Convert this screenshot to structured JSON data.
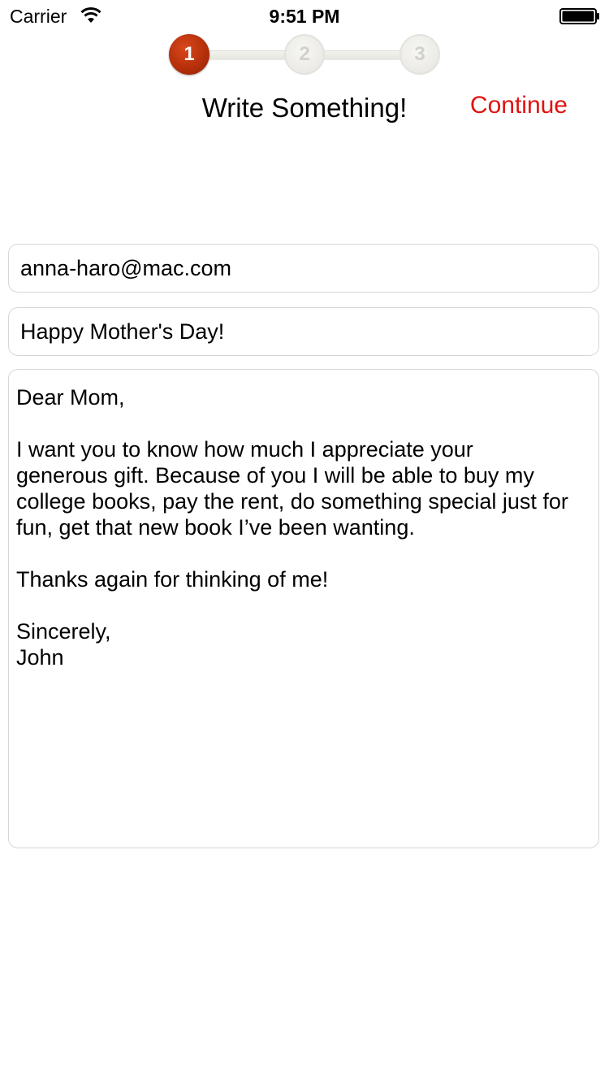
{
  "status_bar": {
    "carrier": "Carrier",
    "time": "9:51 PM"
  },
  "stepper": {
    "steps": [
      "1",
      "2",
      "3"
    ],
    "active_step": 1
  },
  "nav": {
    "title": "Write Something!",
    "continue_label": "Continue"
  },
  "form": {
    "to": "anna-haro@mac.com",
    "subject": "Happy Mother's Day!",
    "message": {
      "greeting": "Dear Mom,",
      "body_line1": "I want you to know how much I appreciate your",
      "body_line2": "generous gift. Because of you I will be able to buy my",
      "body_line3": "college books, pay the rent, do something special just for",
      "body_line4": "fun, get that new book I’ve been wanting.",
      "thanks": "Thanks again for thinking of me!",
      "closing": "Sincerely,",
      "signature": "John"
    }
  },
  "colors": {
    "accent": "#e0130f",
    "step_active": "#b6300b",
    "step_inactive": "#ebeae6"
  },
  "icons": [
    "wifi-icon",
    "battery-icon"
  ]
}
